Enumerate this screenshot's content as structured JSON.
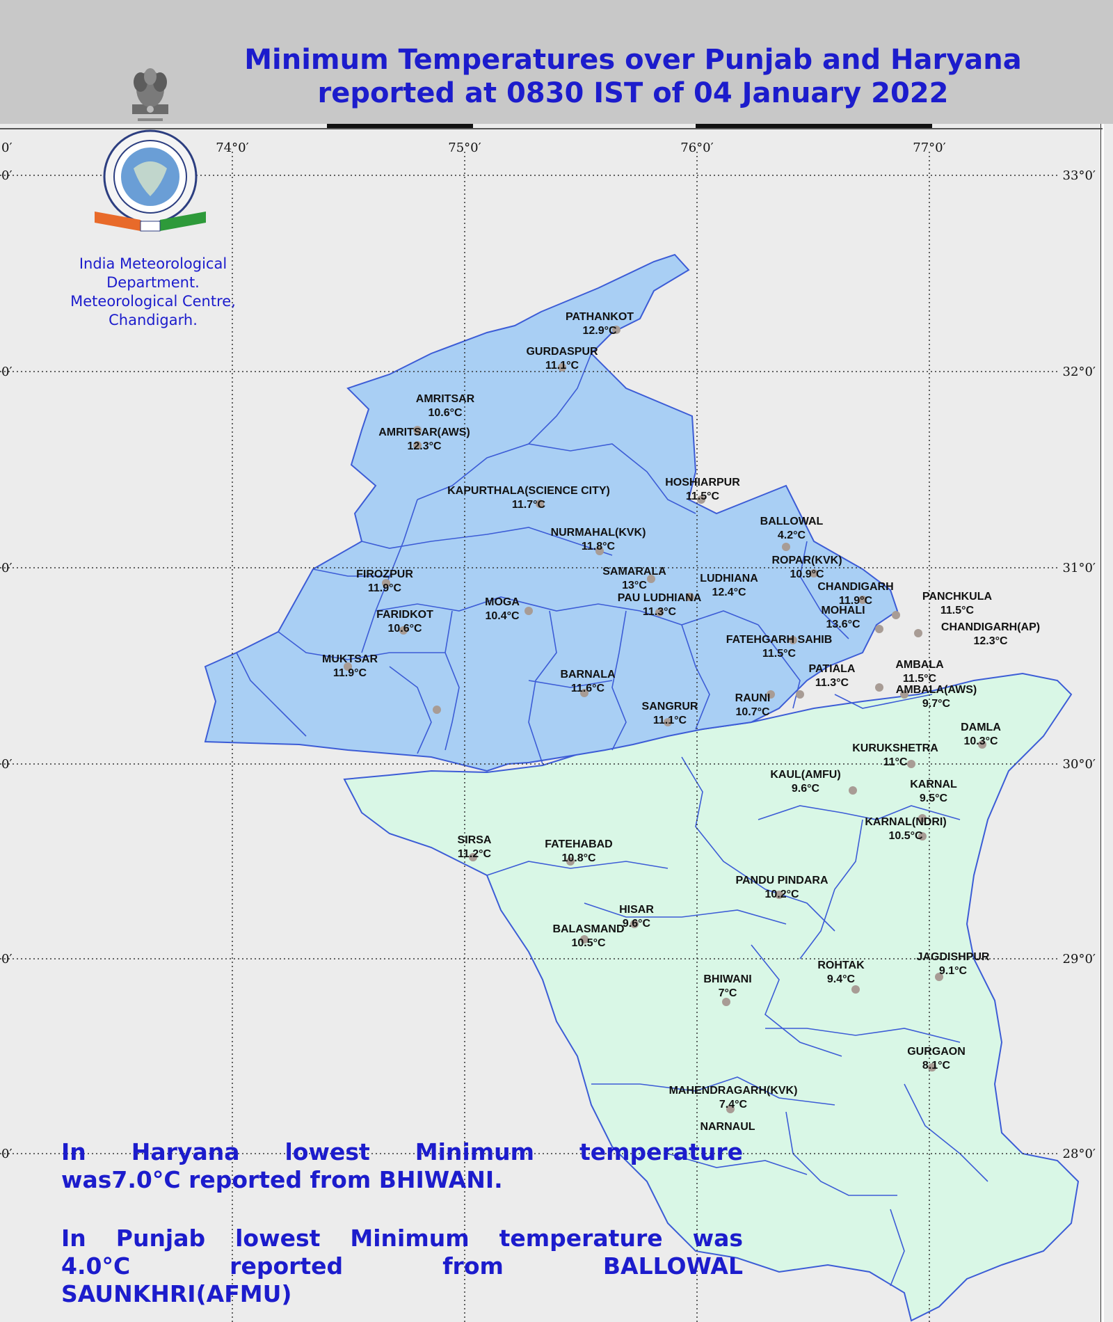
{
  "title": {
    "line1": "Minimum Temperatures over Punjab and Haryana",
    "line2": "reported at 0830 IST of 04 January 2022"
  },
  "organization": {
    "line1": "India Meteorological",
    "line2": "Department.",
    "line3": "Meteorological Centre,",
    "line4": "Chandigarh."
  },
  "logo": {
    "icon": "imd-logo",
    "emblem": "national-emblem"
  },
  "axes": {
    "longitude_labels": [
      "74°0′",
      "75°0′",
      "76°0′",
      "77°0′"
    ],
    "latitude_labels": [
      "33°0′",
      "32°0′",
      "31°0′",
      "30°0′",
      "29°0′",
      "28°0′"
    ],
    "edge_left_label": "0′"
  },
  "colors": {
    "punjab": "#a9cff4",
    "haryana": "#d9f7e6",
    "title": "#1c1ccc",
    "station_dot": "#a89c95"
  },
  "stations": [
    {
      "name": "PATHANKOT",
      "temp": "12.9°C",
      "state": "Punjab"
    },
    {
      "name": "GURDASPUR",
      "temp": "11.1°C",
      "state": "Punjab"
    },
    {
      "name": "AMRITSAR",
      "temp": "10.6°C",
      "state": "Punjab"
    },
    {
      "name": "AMRITSAR(AWS)",
      "temp": "12.3°C",
      "state": "Punjab"
    },
    {
      "name": "KAPURTHALA(SCIENCE CITY)",
      "temp": "11.7°C",
      "state": "Punjab"
    },
    {
      "name": "HOSHIARPUR",
      "temp": "11.5°C",
      "state": "Punjab"
    },
    {
      "name": "BALLOWAL",
      "temp": "4.2°C",
      "state": "Punjab"
    },
    {
      "name": "NURMAHAL(KVK)",
      "temp": "11.8°C",
      "state": "Punjab"
    },
    {
      "name": "ROPAR(KVK)",
      "temp": "10.9°C",
      "state": "Punjab"
    },
    {
      "name": "SAMARALA",
      "temp": "13°C",
      "state": "Punjab"
    },
    {
      "name": "LUDHIANA",
      "temp": "12.4°C",
      "state": "Punjab"
    },
    {
      "name": "FIROZPUR",
      "temp": "11.9°C",
      "state": "Punjab"
    },
    {
      "name": "CHANDIGARH",
      "temp": "11.9°C",
      "state": "Chandigarh"
    },
    {
      "name": "PANCHKULA",
      "temp": "11.5°C",
      "state": "Haryana"
    },
    {
      "name": "PAU LUDHIANA",
      "temp": "11.3°C",
      "state": "Punjab"
    },
    {
      "name": "MOGA",
      "temp": "10.4°C",
      "state": "Punjab"
    },
    {
      "name": "MOHALI",
      "temp": "13.6°C",
      "state": "Punjab"
    },
    {
      "name": "FARIDKOT",
      "temp": "10.6°C",
      "state": "Punjab"
    },
    {
      "name": "CHANDIGARH(AP)",
      "temp": "12.3°C",
      "state": "Chandigarh"
    },
    {
      "name": "FATEHGARH SAHIB",
      "temp": "11.5°C",
      "state": "Punjab"
    },
    {
      "name": "MUKTSAR",
      "temp": "11.9°C",
      "state": "Punjab"
    },
    {
      "name": "AMBALA",
      "temp": "11.5°C",
      "state": "Haryana"
    },
    {
      "name": "PATIALA",
      "temp": "11.3°C",
      "state": "Punjab"
    },
    {
      "name": "BARNALA",
      "temp": "11.6°C",
      "state": "Punjab"
    },
    {
      "name": "AMBALA(AWS)",
      "temp": "9.7°C",
      "state": "Haryana"
    },
    {
      "name": "RAUNI",
      "temp": "10.7°C",
      "state": "Punjab"
    },
    {
      "name": "SANGRUR",
      "temp": "11.1°C",
      "state": "Punjab"
    },
    {
      "name": "DAMLA",
      "temp": "10.3°C",
      "state": "Haryana"
    },
    {
      "name": "KURUKSHETRA",
      "temp": "11°C",
      "state": "Haryana"
    },
    {
      "name": "KAUL(AMFU)",
      "temp": "9.6°C",
      "state": "Haryana"
    },
    {
      "name": "KARNAL",
      "temp": "9.5°C",
      "state": "Haryana"
    },
    {
      "name": "KARNAL(NDRI)",
      "temp": "10.5°C",
      "state": "Haryana"
    },
    {
      "name": "SIRSA",
      "temp": "11.2°C",
      "state": "Haryana"
    },
    {
      "name": "FATEHABAD",
      "temp": "10.8°C",
      "state": "Haryana"
    },
    {
      "name": "PANDU PINDARA",
      "temp": "10.2°C",
      "state": "Haryana"
    },
    {
      "name": "HISAR",
      "temp": "9.6°C",
      "state": "Haryana"
    },
    {
      "name": "BALASMAND",
      "temp": "10.5°C",
      "state": "Haryana"
    },
    {
      "name": "JAGDISHPUR",
      "temp": "9.1°C",
      "state": "Haryana"
    },
    {
      "name": "ROHTAK",
      "temp": "9.4°C",
      "state": "Haryana"
    },
    {
      "name": "BHIWANI",
      "temp": "7°C",
      "state": "Haryana"
    },
    {
      "name": "GURGAON",
      "temp": "8.1°C",
      "state": "Haryana"
    },
    {
      "name": "MAHENDRAGARH(KVK)",
      "temp": "7.4°C",
      "state": "Haryana"
    },
    {
      "name": "NARNAUL",
      "temp": "",
      "state": "Haryana"
    }
  ],
  "notes": {
    "haryana_line1": "In Haryana lowest Minimum temperature",
    "haryana_line2": "was7.0°C reported from BHIWANI.",
    "punjab_line1": "In Punjab lowest Minimum temperature was",
    "punjab_line2": "4.0°C reported from BALLOWAL",
    "punjab_line3": "SAUNKHRI(AFMU)"
  }
}
